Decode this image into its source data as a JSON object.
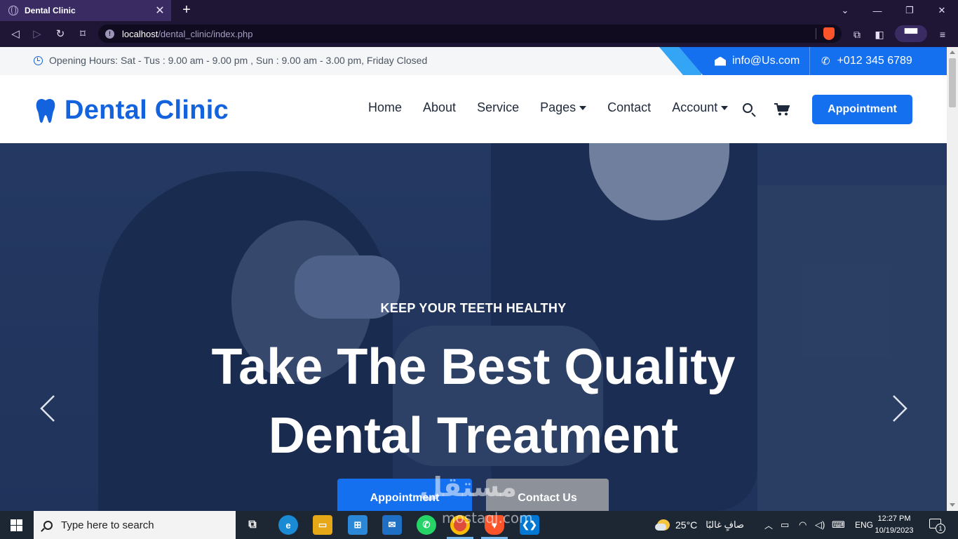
{
  "browser": {
    "tab_title": "Dental Clinic",
    "tab_close": "✕",
    "new_tab": "+",
    "url_host": "localhost",
    "url_path": "/dental_clinic/index.php",
    "window_controls": {
      "minimize": "⌄",
      "restore": "—",
      "maximize": "❐",
      "close": "✕"
    },
    "theme_color": "#1f1535"
  },
  "topbar": {
    "hours": "Opening Hours: Sat - Tus : 9.00 am - 9.00 pm , Sun : 9.00 am - 3.00 pm, Friday Closed",
    "email": "info@Us.com",
    "phone": "+012 345 6789"
  },
  "header": {
    "logo_text": "Dental Clinic",
    "menu": [
      {
        "label": "Home"
      },
      {
        "label": "About"
      },
      {
        "label": "Service"
      },
      {
        "label": "Pages",
        "dropdown": true
      },
      {
        "label": "Contact"
      },
      {
        "label": "Account",
        "dropdown": true
      }
    ],
    "appointment_label": "Appointment",
    "brand_color": "#1363df"
  },
  "hero": {
    "kicker": "KEEP YOUR TEETH HEALTHY",
    "title_line1": "Take The Best Quality",
    "title_line2": "Dental Treatment",
    "primary_button": "Appointment",
    "secondary_button": "Contact Us"
  },
  "taskbar": {
    "search_placeholder": "Type here to search",
    "weather_temp": "25°C",
    "weather_text": "صافٍ غالبًا",
    "language": "ENG",
    "time": "12:27 PM",
    "date": "10/19/2023",
    "notification_count": "1"
  },
  "watermark": {
    "text": "مستقل",
    "sub": "mostaql.com"
  }
}
